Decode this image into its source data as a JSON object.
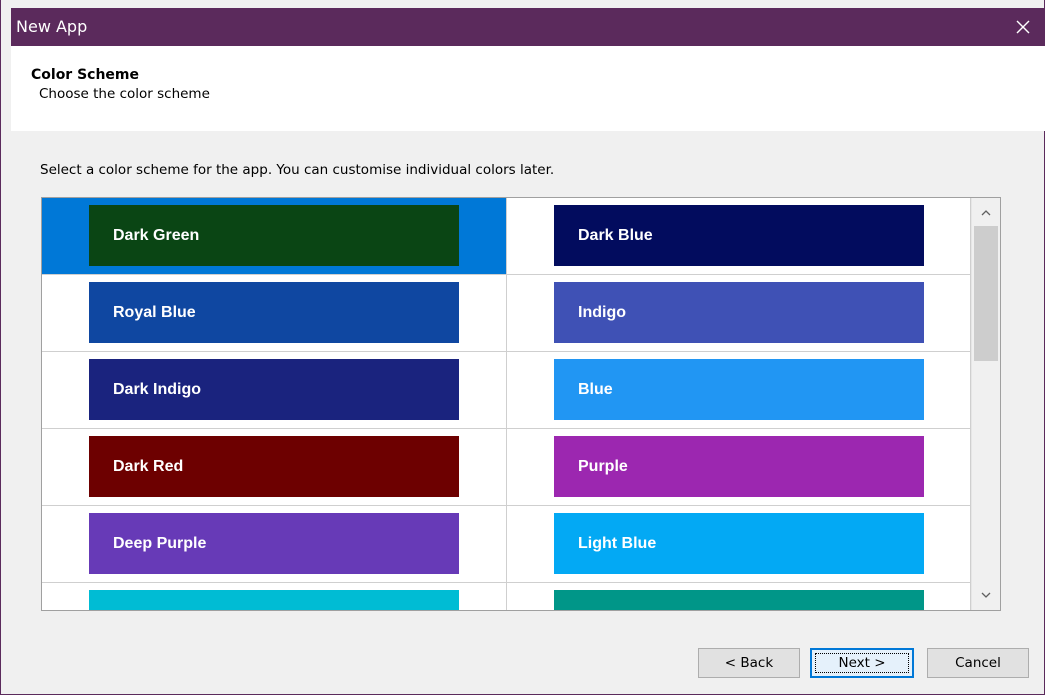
{
  "window": {
    "title": "New App"
  },
  "header": {
    "title": "Color Scheme",
    "subtitle": "Choose the color scheme"
  },
  "instruction": "Select a color scheme for the app. You can customise individual colors later.",
  "selected_index": 0,
  "colors": {
    "titlebar": "#5b2a5c",
    "selection": "#0078d7"
  },
  "schemes": [
    {
      "label": "Dark Green",
      "color": "#0a4514"
    },
    {
      "label": "Dark Blue",
      "color": "#020c5e"
    },
    {
      "label": "Royal Blue",
      "color": "#0f47a1"
    },
    {
      "label": "Indigo",
      "color": "#3f51b5"
    },
    {
      "label": "Dark Indigo",
      "color": "#1a237e"
    },
    {
      "label": "Blue",
      "color": "#2196f3"
    },
    {
      "label": "Dark Red",
      "color": "#6d0000"
    },
    {
      "label": "Purple",
      "color": "#9c27b0"
    },
    {
      "label": "Deep Purple",
      "color": "#673ab7"
    },
    {
      "label": "Light Blue",
      "color": "#03a9f4"
    },
    {
      "label": "",
      "color": "#00bcd4"
    },
    {
      "label": "",
      "color": "#009688"
    }
  ],
  "buttons": {
    "back": "< Back",
    "next": "Next >",
    "cancel": "Cancel"
  },
  "icons": {
    "close": "close-icon",
    "scroll_up": "chevron-up-icon",
    "scroll_down": "chevron-down-icon"
  }
}
